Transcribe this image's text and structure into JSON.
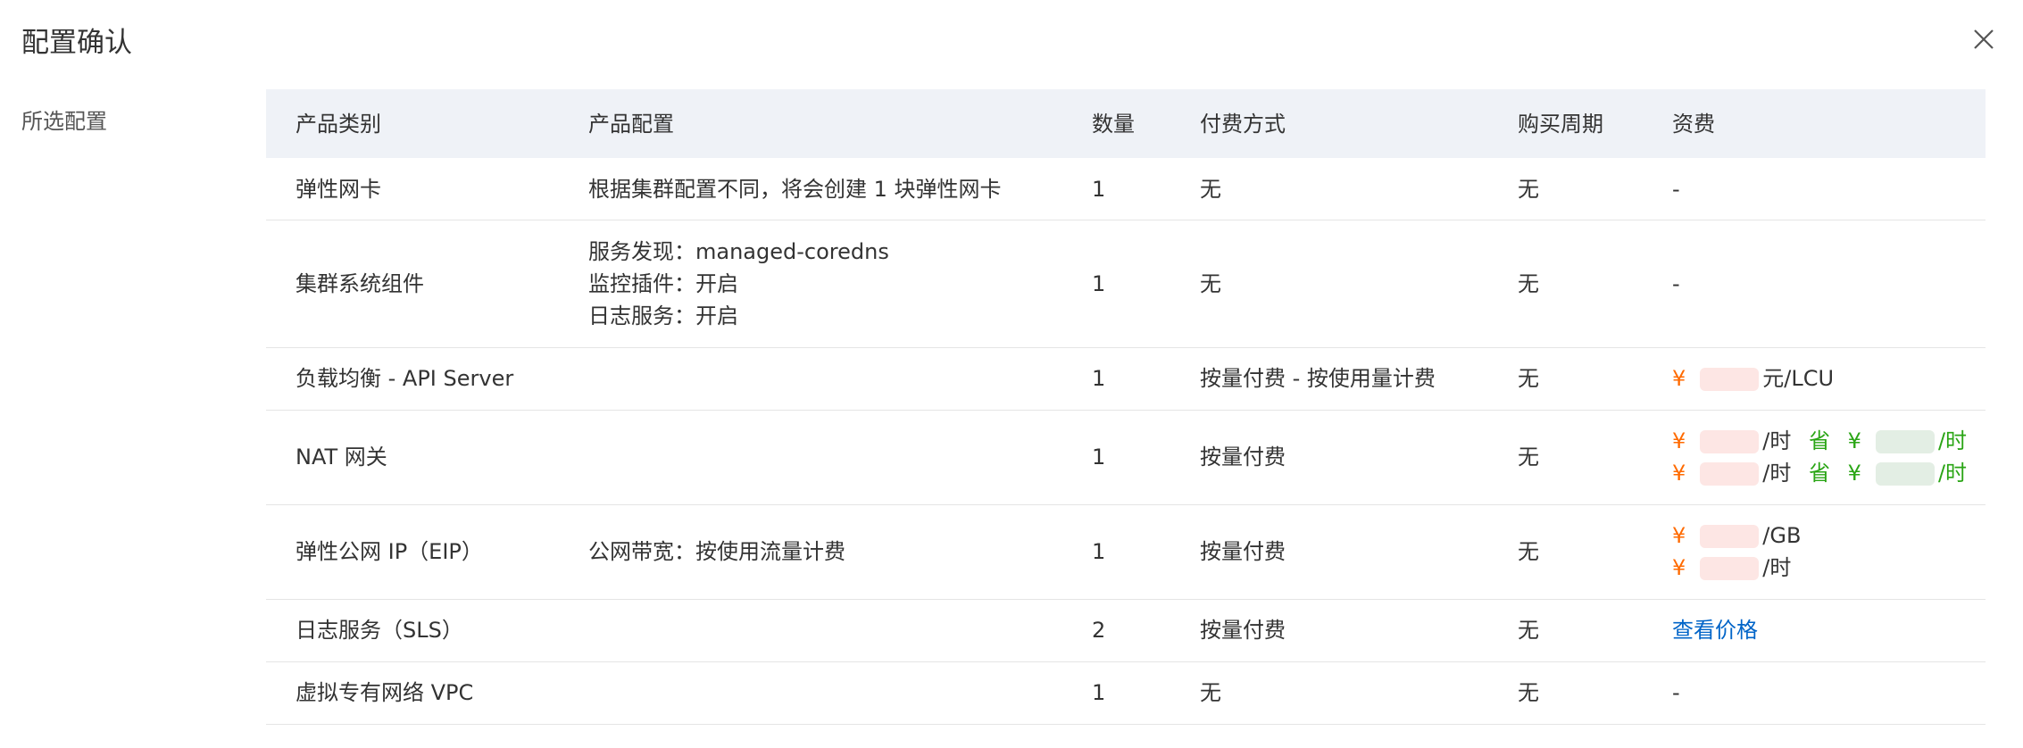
{
  "dialog": {
    "title": "配置确认",
    "section_label": "所选配置"
  },
  "columns": [
    "产品类别",
    "产品配置",
    "数量",
    "付费方式",
    "购买周期",
    "资费"
  ],
  "rows": [
    {
      "category": "弹性网卡",
      "config": [
        "根据集群配置不同，将会创建 1 块弹性网卡"
      ],
      "qty": "1",
      "billing": "无",
      "period": "无",
      "fee": "-"
    },
    {
      "category": "集群系统组件",
      "config": [
        "服务发现：managed-coredns",
        "监控插件：开启",
        "日志服务：开启"
      ],
      "qty": "1",
      "billing": "无",
      "period": "无",
      "fee": "-"
    },
    {
      "category": "负载均衡 - API Server",
      "config": [],
      "qty": "1",
      "billing": "按量付费 - 按使用量计费",
      "period": "无",
      "fee_yen": "¥",
      "fee_unit": "元/LCU"
    },
    {
      "category": "NAT 网关",
      "config": [],
      "qty": "1",
      "billing": "按量付费",
      "period": "无",
      "fee_lines": [
        {
          "yen": "¥",
          "unit": "/时",
          "save": "省",
          "save_yen": "¥",
          "save_unit": "/时"
        },
        {
          "yen": "¥",
          "unit": "/时",
          "save": "省",
          "save_yen": "¥",
          "save_unit": "/时"
        }
      ]
    },
    {
      "category": "弹性公网 IP（EIP）",
      "config": [
        "公网带宽：按使用流量计费"
      ],
      "qty": "1",
      "billing": "按量付费",
      "period": "无",
      "fee_lines": [
        {
          "yen": "¥",
          "unit": "/GB"
        },
        {
          "yen": "¥",
          "unit": "/时"
        }
      ]
    },
    {
      "category": "日志服务（SLS）",
      "config": [],
      "qty": "2",
      "billing": "按量付费",
      "period": "无",
      "fee_link": "查看价格"
    },
    {
      "category": "虚拟专有网络 VPC",
      "config": [],
      "qty": "1",
      "billing": "无",
      "period": "无",
      "fee": "-"
    }
  ],
  "icons": {
    "close": "close-icon"
  },
  "colors": {
    "header_bg": "#eff2f7",
    "price": "#ff6a00",
    "save": "#2aa515",
    "link": "#0064c8"
  }
}
